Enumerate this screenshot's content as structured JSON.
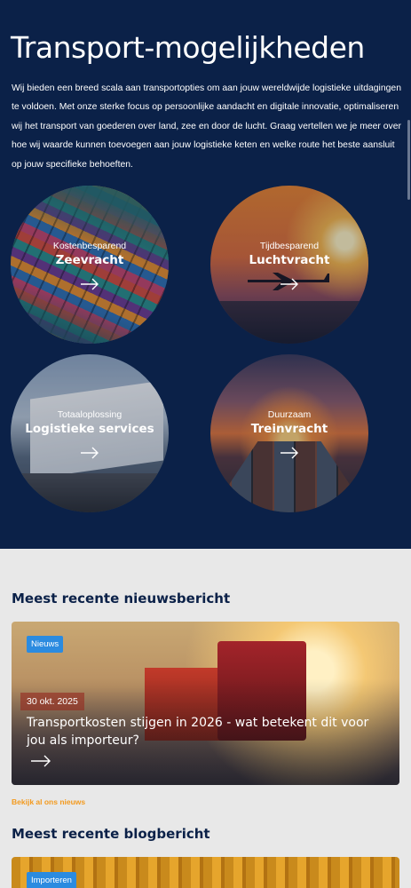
{
  "hero": {
    "title": "Transport-mogelijkheden",
    "intro": "Wij bieden een breed scala aan transportopties om aan jouw wereldwijde logistieke uitdagingen te voldoen. Met onze sterke focus op persoonlijke aandacht en digitale innovatie, optimaliseren wij het transport van goederen over land, zee en door de lucht. Graag vertellen we je meer over hoe wij waarde kunnen toevoegen aan jouw logistieke keten en welke route het beste aansluit op jouw specifieke behoeften."
  },
  "options": [
    {
      "subtitle": "Kostenbesparend",
      "title": "Zeevracht"
    },
    {
      "subtitle": "Tijdbesparend",
      "title": "Luchtvracht"
    },
    {
      "subtitle": "Totaaloplossing",
      "title": "Logistieke services"
    },
    {
      "subtitle": "Duurzaam",
      "title": "Treinvracht"
    }
  ],
  "news": {
    "heading": "Meest recente nieuwsbericht",
    "tag": "Nieuws",
    "date": "30 okt. 2025",
    "title": "Transportkosten stijgen in 2026 - wat betekent dit voor jou als importeur?",
    "more_link": "Bekijk al ons nieuws"
  },
  "blog": {
    "heading": "Meest recente blogbericht",
    "tag": "Importeren"
  },
  "colors": {
    "hero_bg": "#0b2148",
    "accent_orange": "#f39a1e",
    "tag_blue": "#2b8be0"
  }
}
